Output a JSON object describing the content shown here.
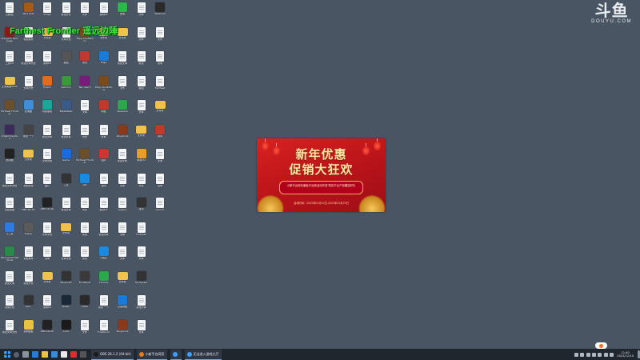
{
  "overlay_title": "Farthest Frontier 遥远边陲",
  "watermark": {
    "big": "斗鱼",
    "small": "DOUYU.COM"
  },
  "banner": {
    "line1": "新年优惠",
    "line2": "促销大狂欢",
    "ribbon_text": "小新平台网页面板平台新活动开放 购买平台产品赠送好礼",
    "date_text": "活动时间：2022年01月10日-2022年01月20日"
  },
  "desktop_icons": [
    {
      "label": "回收站",
      "kind": "doc"
    },
    {
      "label": "Dungeon Rampage",
      "kind": "img",
      "color": "#8b1a1a"
    },
    {
      "label": "王者txt",
      "kind": "doc"
    },
    {
      "label": "王者荣耀2022",
      "kind": "folder"
    },
    {
      "label": "Farthest Frontier",
      "kind": "img",
      "color": "#6b4f2a"
    },
    {
      "label": "Knight Payload",
      "kind": "img",
      "color": "#3b2a5a"
    },
    {
      "label": "启动器",
      "kind": "img",
      "color": "#222"
    },
    {
      "label": "新建文本文档",
      "kind": "doc"
    },
    {
      "label": "视频截图",
      "kind": "doc"
    },
    {
      "label": "小工具",
      "kind": "img",
      "color": "#2d7be0"
    },
    {
      "label": "Stronghold Warlords",
      "kind": "img",
      "color": "#2a8a4a"
    },
    {
      "label": "新建文本",
      "kind": "doc"
    },
    {
      "label": "说明文档",
      "kind": "doc"
    },
    {
      "label": "新建文本文档",
      "kind": "doc"
    },
    {
      "label": "Wild Wild",
      "kind": "img",
      "color": "#a45b1a"
    },
    {
      "label": "视频素材",
      "kind": "doc"
    },
    {
      "label": "新建文本文档",
      "kind": "doc"
    },
    {
      "label": "文本文档",
      "kind": "doc"
    },
    {
      "label": "此电脑",
      "kind": "img",
      "color": "#3d8fd9"
    },
    {
      "label": "新建 一个",
      "kind": "img",
      "color": "#444"
    },
    {
      "label": "文件夹",
      "kind": "folder"
    },
    {
      "label": "视频剪辑",
      "kind": "doc"
    },
    {
      "label": "OBS Studio",
      "kind": "doc"
    },
    {
      "label": "Sniper",
      "kind": "img",
      "color": "#5a5a5a"
    },
    {
      "label": "视频素材",
      "kind": "doc"
    },
    {
      "label": "新建文件",
      "kind": "doc"
    },
    {
      "label": "Epic",
      "kind": "img",
      "color": "#333"
    },
    {
      "label": "控制面板",
      "kind": "img",
      "color": "#e8c240"
    },
    {
      "label": "image",
      "kind": "doc"
    },
    {
      "label": "文件夹",
      "kind": "folder"
    },
    {
      "label": "说明txt",
      "kind": "doc"
    },
    {
      "label": "Firefox",
      "kind": "img",
      "color": "#e66a1a"
    },
    {
      "label": "视频编辑",
      "kind": "img",
      "color": "#1aa89a"
    },
    {
      "label": "新建文本",
      "kind": "doc"
    },
    {
      "label": "文本文档",
      "kind": "doc"
    },
    {
      "label": "图片",
      "kind": "doc"
    },
    {
      "label": "OBS Studio",
      "kind": "img",
      "color": "#222"
    },
    {
      "label": "文本文档",
      "kind": "doc"
    },
    {
      "label": "说明",
      "kind": "doc"
    },
    {
      "label": "文件夹",
      "kind": "folder"
    },
    {
      "label": "说明txt",
      "kind": "doc"
    },
    {
      "label": "OBS Studio",
      "kind": "img",
      "color": "#222"
    },
    {
      "label": "新建文件",
      "kind": "doc"
    },
    {
      "label": "文本文档",
      "kind": "doc"
    },
    {
      "label": "截图",
      "kind": "img",
      "color": "#555"
    },
    {
      "label": "GeForce",
      "kind": "img",
      "color": "#3a9a3a"
    },
    {
      "label": "Battlefleet",
      "kind": "img",
      "color": "#3a5a8a"
    },
    {
      "label": "新建文本",
      "kind": "doc"
    },
    {
      "label": "Game",
      "kind": "img",
      "color": "#1a6ae0"
    },
    {
      "label": "工具",
      "kind": "img",
      "color": "#333"
    },
    {
      "label": "新建文本",
      "kind": "doc"
    },
    {
      "label": "文件夹",
      "kind": "folder"
    },
    {
      "label": "文本文档",
      "kind": "doc"
    },
    {
      "label": "Minecraft",
      "kind": "img",
      "color": "#333"
    },
    {
      "label": "Steam",
      "kind": "img",
      "color": "#1b2838"
    },
    {
      "label": "Anno",
      "kind": "img",
      "color": "#1a1a1a"
    },
    {
      "label": "文件",
      "kind": "doc"
    },
    {
      "label": "They Are Billions",
      "kind": "img",
      "color": "#7a4a1a"
    },
    {
      "label": "游戏",
      "kind": "img",
      "color": "#c0392b"
    },
    {
      "label": "Two Year's",
      "kind": "img",
      "color": "#7a1a7a"
    },
    {
      "label": "文本",
      "kind": "doc"
    },
    {
      "label": "文件",
      "kind": "doc"
    },
    {
      "label": "Farthest Frontier",
      "kind": "img",
      "color": "#6b4f2a"
    },
    {
      "label": "QQ",
      "kind": "img",
      "color": "#1a8ae0"
    },
    {
      "label": "文件",
      "kind": "doc"
    },
    {
      "label": "新建",
      "kind": "doc"
    },
    {
      "label": "新建",
      "kind": "doc"
    },
    {
      "label": "FrostPunk",
      "kind": "img",
      "color": "#3a3a3a"
    },
    {
      "label": "Clash",
      "kind": "img",
      "color": "#2a2a2a"
    },
    {
      "label": "文件",
      "kind": "doc"
    },
    {
      "label": "说明txt",
      "kind": "doc"
    },
    {
      "label": "文件夹",
      "kind": "folder"
    },
    {
      "label": "Edge",
      "kind": "img",
      "color": "#1a7ad8"
    },
    {
      "label": "They Are Billions",
      "kind": "img",
      "color": "#7a4a1a"
    },
    {
      "label": "网盘",
      "kind": "img",
      "color": "#c0392b"
    },
    {
      "label": "文本",
      "kind": "doc"
    },
    {
      "label": "图片",
      "kind": "img",
      "color": "#d63031"
    },
    {
      "label": "说明",
      "kind": "doc"
    },
    {
      "label": "说明txt",
      "kind": "doc"
    },
    {
      "label": "新建文本",
      "kind": "doc"
    },
    {
      "label": "小程序",
      "kind": "img",
      "color": "#1a8ae0"
    },
    {
      "label": "Chrome",
      "kind": "img",
      "color": "#2aa84a"
    },
    {
      "label": "新建 一个",
      "kind": "doc"
    },
    {
      "label": "Frostpunk",
      "kind": "doc"
    },
    {
      "label": "微信",
      "kind": "img",
      "color": "#2ab84a"
    },
    {
      "label": "文件夹",
      "kind": "folder"
    },
    {
      "label": "新建文本",
      "kind": "doc"
    },
    {
      "label": "文件",
      "kind": "doc"
    },
    {
      "label": "WeGame",
      "kind": "img",
      "color": "#2aa84a"
    },
    {
      "label": "Kingdoms",
      "kind": "img",
      "color": "#8a3a1a"
    },
    {
      "label": "新建文本",
      "kind": "doc"
    },
    {
      "label": "文本",
      "kind": "doc"
    },
    {
      "label": "Legacy",
      "kind": "doc"
    },
    {
      "label": "说明",
      "kind": "doc"
    },
    {
      "label": "文本",
      "kind": "doc"
    },
    {
      "label": "文件夹",
      "kind": "folder"
    },
    {
      "label": "百度网盘",
      "kind": "img",
      "color": "#1a7ad8"
    },
    {
      "label": "Kingdoms",
      "kind": "img",
      "color": "#8a3a1a"
    },
    {
      "label": "文本",
      "kind": "doc"
    },
    {
      "label": "文本",
      "kind": "doc"
    },
    {
      "label": "新建",
      "kind": "doc"
    },
    {
      "label": "截图",
      "kind": "doc"
    },
    {
      "label": "文本",
      "kind": "doc"
    },
    {
      "label": "文件夹",
      "kind": "folder"
    },
    {
      "label": "网易UU",
      "kind": "img",
      "color": "#e8a020"
    },
    {
      "label": "文件",
      "kind": "doc"
    },
    {
      "label": "游戏",
      "kind": "img",
      "color": "#333"
    },
    {
      "label": "Farthest",
      "kind": "doc"
    },
    {
      "label": "文本",
      "kind": "doc"
    },
    {
      "label": "S2 Fighter",
      "kind": "img",
      "color": "#333"
    },
    {
      "label": "新建文本",
      "kind": "doc"
    },
    {
      "label": "文本",
      "kind": "doc"
    },
    {
      "label": "WeGame",
      "kind": "img",
      "color": "#2a2a2a"
    },
    {
      "label": "文件",
      "kind": "doc"
    },
    {
      "label": "说明",
      "kind": "doc"
    },
    {
      "label": "Farthest",
      "kind": "doc"
    },
    {
      "label": "文件夹",
      "kind": "folder"
    },
    {
      "label": "游戏",
      "kind": "img",
      "color": "#c0392b"
    },
    {
      "label": "文本",
      "kind": "doc"
    },
    {
      "label": "说明",
      "kind": "doc"
    },
    {
      "label": "Launch",
      "kind": "doc"
    }
  ],
  "taskbar": {
    "tasks": [
      {
        "label": "OBS 28.1.2 (64-bit)",
        "color": "#1a1a1a"
      },
      {
        "label": "小新平台网页",
        "color": "#e87a1a"
      },
      {
        "label": "",
        "color": "#3aa0ff"
      },
      {
        "label": "无法进入游戏大厅",
        "color": "#3aa0ff"
      }
    ],
    "time": "11:40",
    "date": "2022/12/10"
  }
}
